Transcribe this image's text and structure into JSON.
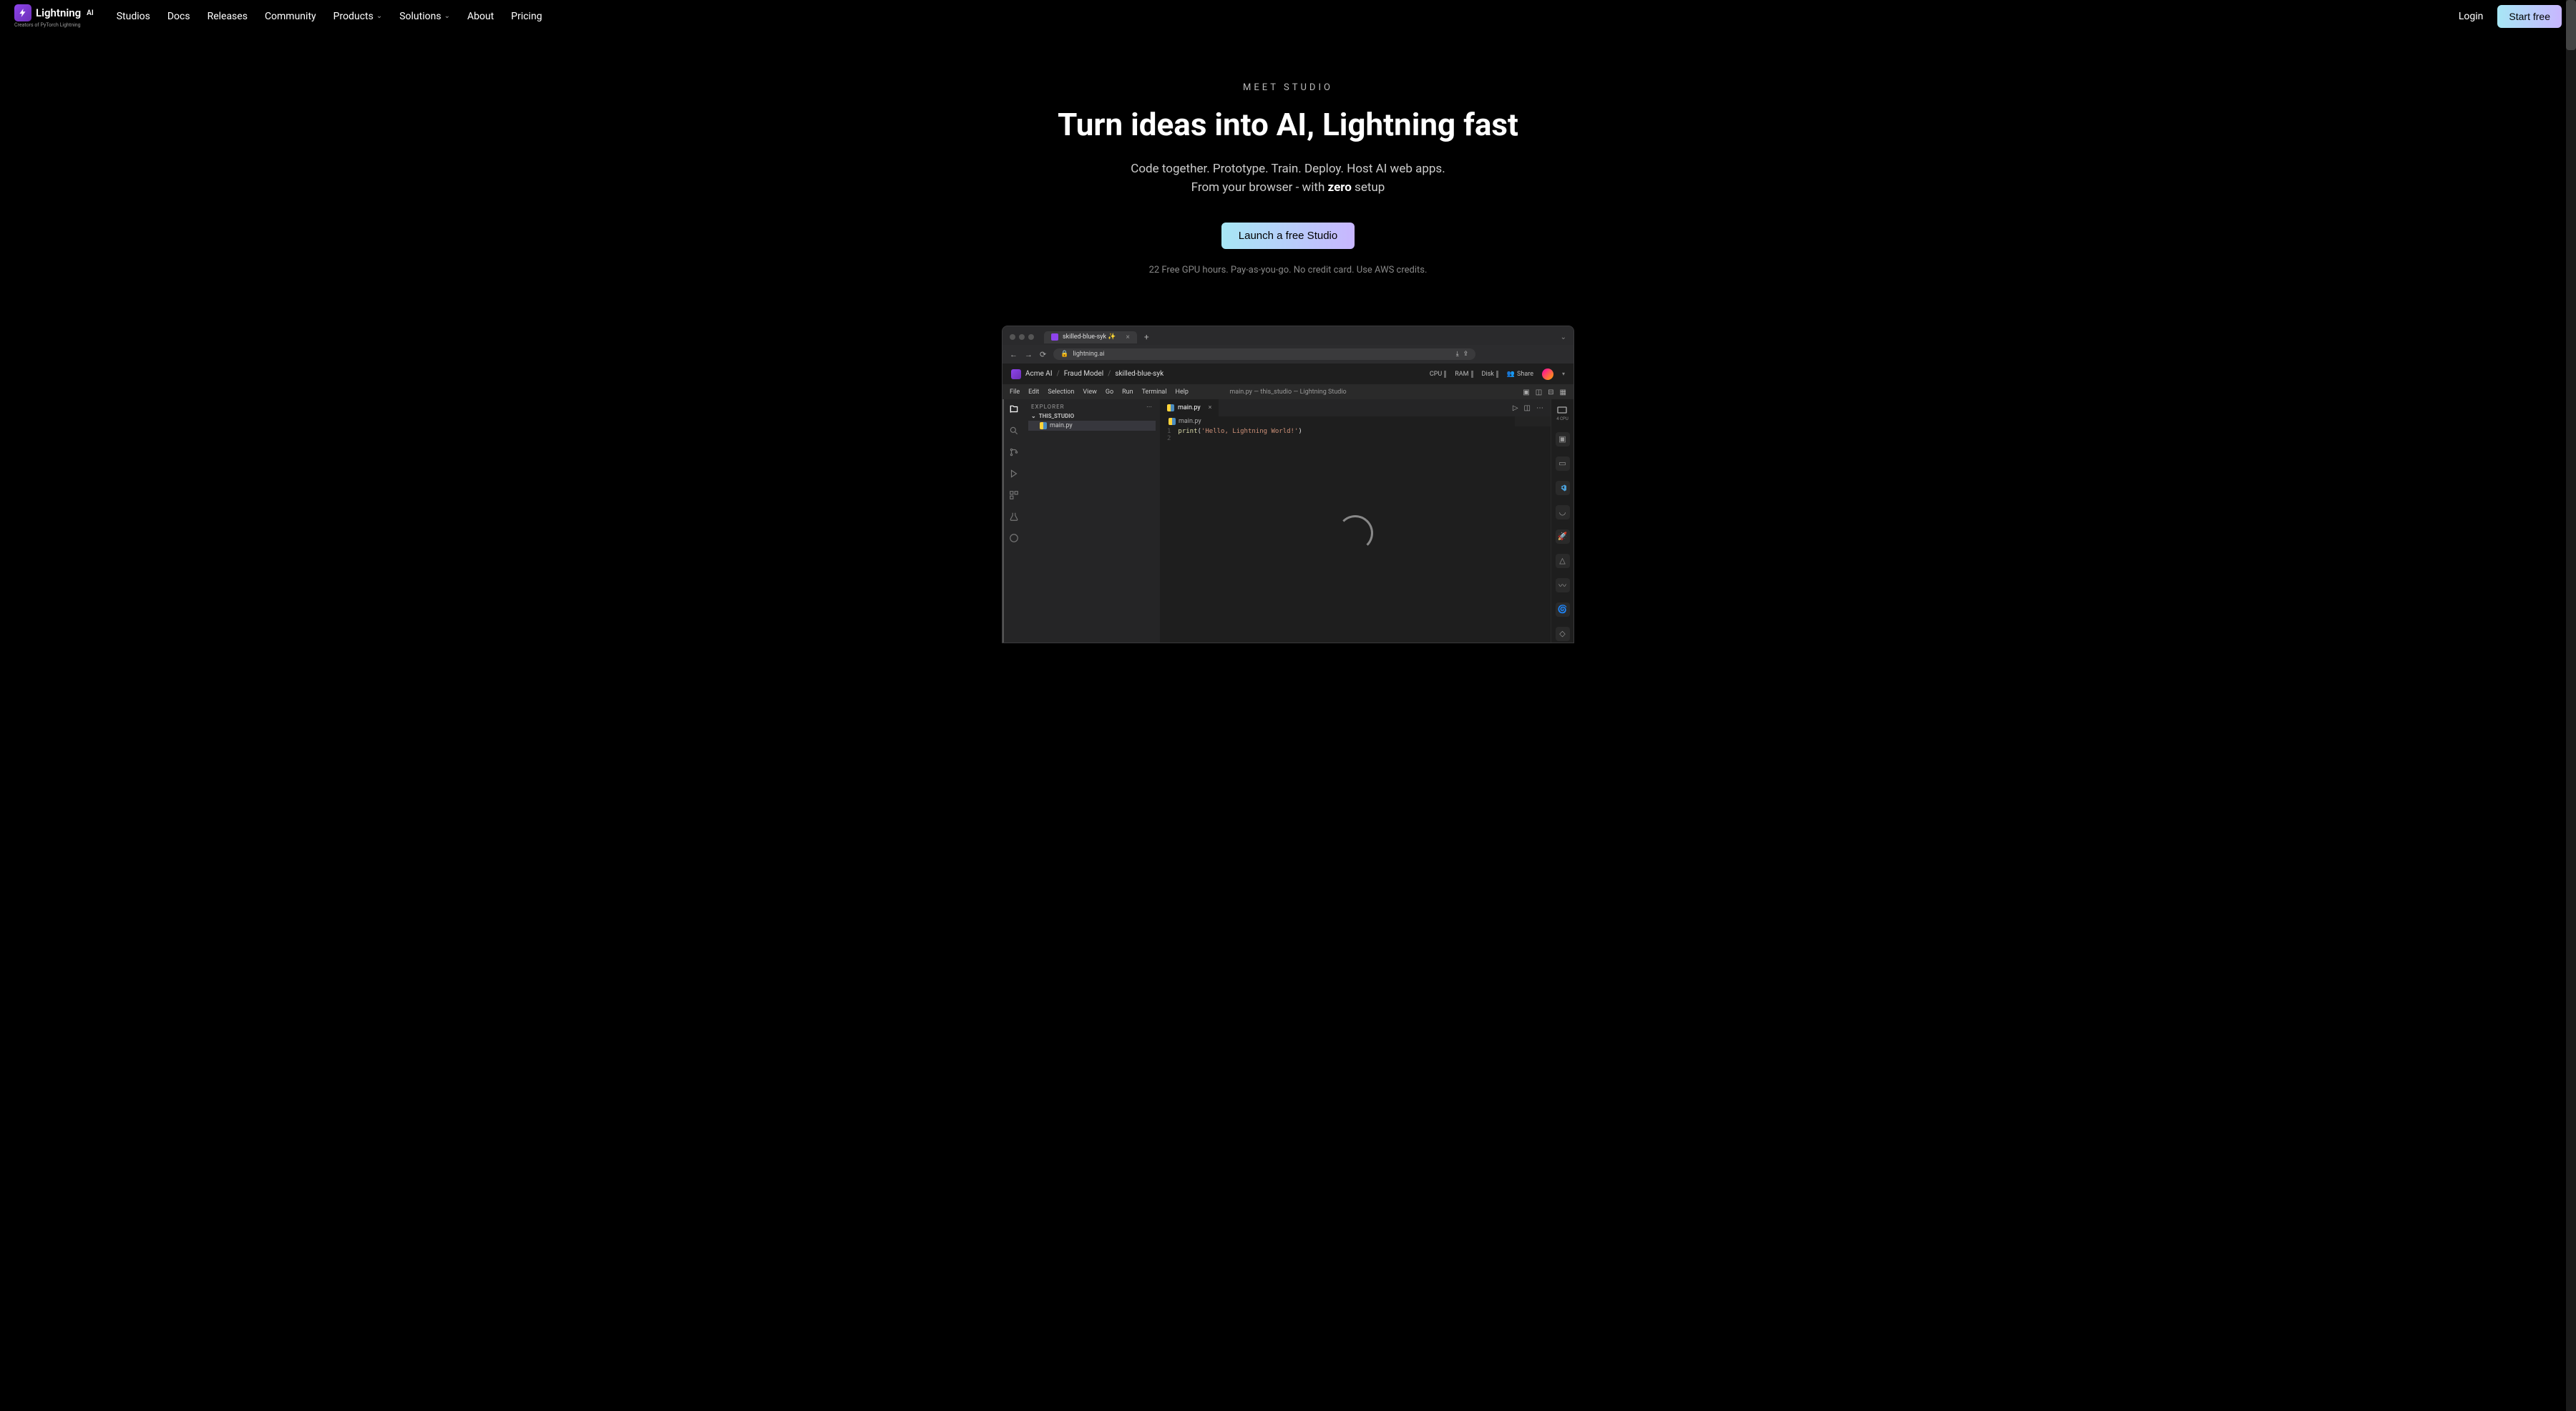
{
  "header": {
    "logo_text": "Lightning",
    "logo_sup": "AI",
    "logo_sub": "Creators of PyTorch Lightning",
    "nav": [
      "Studios",
      "Docs",
      "Releases",
      "Community",
      "Products",
      "Solutions",
      "About",
      "Pricing"
    ],
    "nav_dropdowns": [
      "Products",
      "Solutions"
    ],
    "login": "Login",
    "cta": "Start free"
  },
  "hero": {
    "eyebrow": "MEET STUDIO",
    "title": "Turn ideas into AI, Lightning fast",
    "sub1": "Code together. Prototype. Train. Deploy. Host AI web apps.",
    "sub2_pre": "From your browser - with ",
    "sub2_bold": "zero",
    "sub2_post": " setup",
    "cta": "Launch a free Studio",
    "note": "22 Free GPU hours. Pay-as-you-go. No credit card. Use AWS credits."
  },
  "browser": {
    "tab_title": "skilled-blue-syk ✨",
    "url": "lightning.ai"
  },
  "app": {
    "breadcrumb": [
      "Acme AI",
      "Fraud Model",
      "skilled-blue-syk"
    ],
    "metrics": {
      "cpu": "CPU",
      "ram": "RAM",
      "disk": "Disk"
    },
    "share": "Share"
  },
  "ide": {
    "menu": [
      "File",
      "Edit",
      "Selection",
      "View",
      "Go",
      "Run",
      "Terminal",
      "Help"
    ],
    "title": "main.py — this_studio — Lightning Studio",
    "explorer_label": "EXPLORER",
    "explorer_folder": "THIS_STUDIO",
    "explorer_files": [
      "main.py"
    ],
    "tabs": [
      "main.py"
    ],
    "crumb": "main.py",
    "code": {
      "lines": [
        {
          "n": "1",
          "fn": "print",
          "paren": "(",
          "str": "'Hello, Lightning World!'",
          "end": ")"
        },
        {
          "n": "2",
          "fn": "",
          "paren": "",
          "str": "",
          "end": ""
        }
      ]
    },
    "right_sidebar_top": "4 CPU"
  }
}
